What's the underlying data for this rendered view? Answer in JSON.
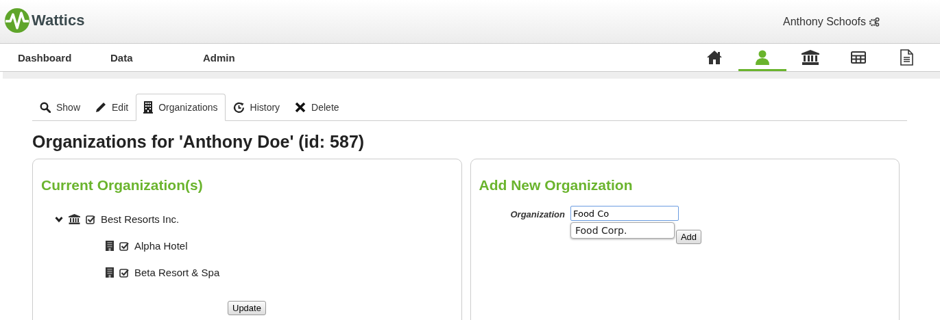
{
  "brand": {
    "name": "Wattics"
  },
  "user": {
    "name": "Anthony Schoofs"
  },
  "menu": [
    {
      "label": "Dashboard"
    },
    {
      "label": "Data"
    },
    {
      "label": "Admin"
    }
  ],
  "nav_icons": [
    {
      "kind": "home",
      "selected": false
    },
    {
      "kind": "user",
      "selected": true
    },
    {
      "kind": "bank",
      "selected": false
    },
    {
      "kind": "table",
      "selected": false
    },
    {
      "kind": "document",
      "selected": false
    }
  ],
  "tabs": [
    {
      "label": "Show",
      "kind": "search",
      "selected": false
    },
    {
      "label": "Edit",
      "kind": "pencil",
      "selected": false
    },
    {
      "label": "Organizations",
      "kind": "building",
      "selected": true
    },
    {
      "label": "History",
      "kind": "history",
      "selected": false
    },
    {
      "label": "Delete",
      "kind": "close",
      "selected": false
    }
  ],
  "heading": "Organizations for 'Anthony Doe' (id: 587)",
  "current": {
    "title": "Current Organization(s)",
    "tree": [
      {
        "name": "Best Resorts Inc.",
        "kind": "bank",
        "checked": true,
        "expanded": true,
        "children": [
          {
            "name": "Alpha Hotel",
            "kind": "building",
            "checked": true
          },
          {
            "name": "Beta Resort & Spa",
            "kind": "building",
            "checked": true
          }
        ]
      }
    ],
    "button": "Update"
  },
  "add": {
    "title": "Add New Organization",
    "label": "Organization",
    "value": "Food Co",
    "suggestions": [
      "Food Corp."
    ],
    "button": "Add"
  }
}
